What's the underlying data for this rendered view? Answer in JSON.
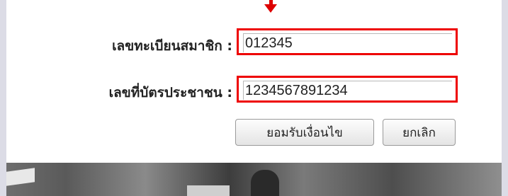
{
  "form": {
    "member_id_label": "เลขทะเบียนสมาชิก :",
    "member_id_value": "012345",
    "citizen_id_label": "เลขที่บัตรประชาชน :",
    "citizen_id_value": "1234567891234"
  },
  "buttons": {
    "accept_label": "ยอมรับเงื่อนไข",
    "cancel_label": "ยกเลิก"
  },
  "colors": {
    "highlight": "#ee0000",
    "page_border": "#dcdce6"
  }
}
